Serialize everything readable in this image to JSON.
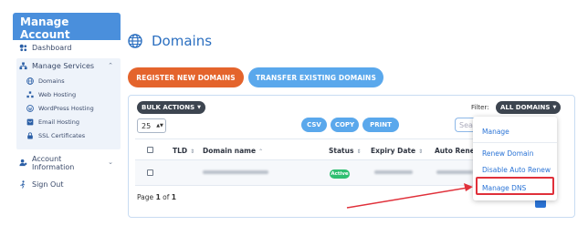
{
  "sidebar": {
    "title": "Manage Account",
    "items": [
      {
        "label": "Dashboard",
        "icon": "dashboard-icon"
      },
      {
        "label": "Manage Services",
        "icon": "services-icon"
      },
      {
        "label": "Account Information",
        "icon": "account-icon"
      },
      {
        "label": "Sign Out",
        "icon": "sign-out-icon"
      }
    ],
    "services": [
      {
        "label": "Domains",
        "icon": "globe-icon"
      },
      {
        "label": "Web Hosting",
        "icon": "hosting-icon"
      },
      {
        "label": "WordPress Hosting",
        "icon": "wordpress-icon"
      },
      {
        "label": "Email Hosting",
        "icon": "email-icon"
      },
      {
        "label": "SSL Certificates",
        "icon": "lock-icon"
      }
    ],
    "account_line1": "Account",
    "account_line2": "Information"
  },
  "page": {
    "title": "Domains",
    "register_label": "REGISTER NEW DOMAINS",
    "transfer_label": "TRANSFER EXISTING DOMAINS"
  },
  "toolbar": {
    "bulk_label": "BULK ACTIONS",
    "filter_label": "Filter:",
    "filter_value": "ALL DOMAINS",
    "per_page": "25",
    "csv_label": "CSV",
    "copy_label": "COPY",
    "print_label": "PRINT",
    "search_placeholder": "Sea"
  },
  "table": {
    "columns": [
      "TLD",
      "Domain name",
      "Status",
      "Expiry Date",
      "Auto Renew"
    ],
    "rows": [
      {
        "tld": "",
        "domain": "",
        "status": "Active",
        "expiry": "",
        "auto_renew": ""
      }
    ]
  },
  "pagination": {
    "prefix": "Page",
    "current": "1",
    "middle": "of",
    "total": "1"
  },
  "dropdown": {
    "items": [
      "Manage",
      "Renew Domain",
      "Disable Auto Renew",
      "Manage DNS"
    ],
    "highlighted": "Manage DNS"
  },
  "colors": {
    "accent": "#2b74d6",
    "register": "#e4642c",
    "transfer": "#5aa8ec",
    "active": "#2fbf71",
    "highlight": "#e0303a"
  }
}
